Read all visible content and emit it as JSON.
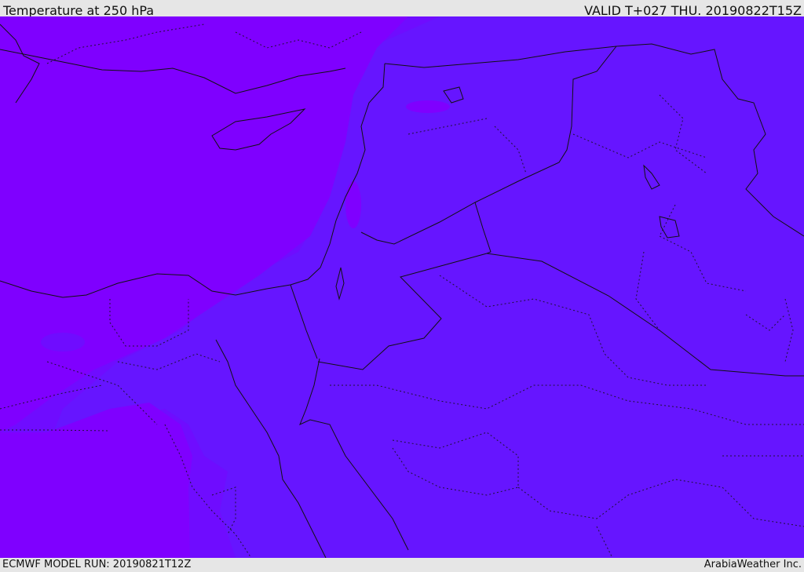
{
  "header": {
    "title": "Temperature at 250 hPa",
    "valid": "VALID T+027 THU. 20190822T15Z"
  },
  "footer": {
    "model_run": "ECMWF MODEL RUN: 20190821T12Z",
    "credit": "ArabiaWeather Inc."
  },
  "map": {
    "colors": {
      "warm_band": "#7f00ff",
      "mid_band": "#6f0cff",
      "cool_band": "#6615ff",
      "border_line": "#111111"
    }
  }
}
